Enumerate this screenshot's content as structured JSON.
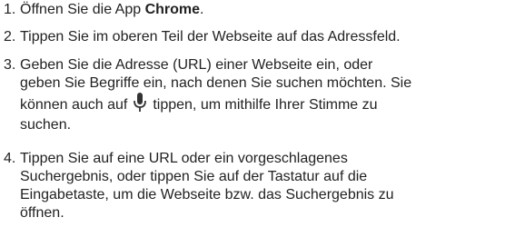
{
  "steps": [
    {
      "number": "1.",
      "before": "Öffnen Sie die App ",
      "bold": "Chrome",
      "after": "."
    },
    {
      "number": "2.",
      "text": "Tippen Sie im oberen Teil der Webseite auf das Adressfeld."
    },
    {
      "number": "3.",
      "line1": "Geben Sie die Adresse (URL) einer Webseite ein, oder",
      "line2": "geben Sie Begriffe ein, nach denen Sie suchen möchten. Sie",
      "line3_before": "können auch auf",
      "icon": "microphone-icon",
      "line3_after": "tippen, um mithilfe Ihrer Stimme zu",
      "line4": "suchen."
    },
    {
      "number": "4.",
      "line1": "Tippen Sie auf eine URL oder ein vorgeschlagenes",
      "line2": "Suchergebnis, oder tippen Sie auf der Tastatur auf die",
      "line3": "Eingabetaste, um die Webseite bzw. das Suchergebnis zu",
      "line4": "öffnen."
    }
  ]
}
